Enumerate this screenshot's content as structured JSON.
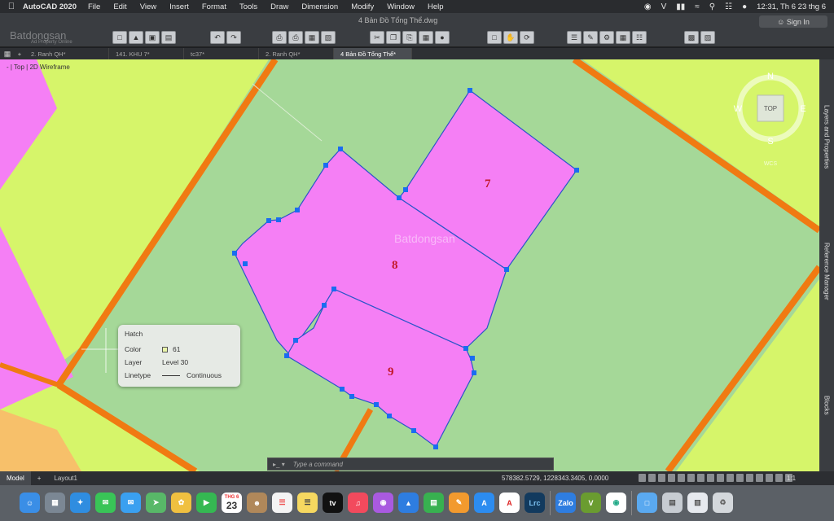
{
  "menubar": {
    "app": "AutoCAD 2020",
    "items": [
      "File",
      "Edit",
      "View",
      "Insert",
      "Format",
      "Tools",
      "Draw",
      "Dimension",
      "Modify",
      "Window",
      "Help"
    ],
    "clock": "12:31, Th 6 23 thg 6"
  },
  "toolbar": {
    "doc_title": "4 Bản Đồ Tổng Thể.dwg",
    "signin": "Sign In",
    "watermark": "Batdongsan",
    "watermark_sub": "Ad Property Online"
  },
  "tabs": [
    "2. Ranh QH*",
    "141. KHU 7*",
    "tc37*",
    "2. Ranh QH*",
    "4 Bản Đồ Tổng Thể*"
  ],
  "viewport_label": "[-][Top][2D Wireframe]",
  "viewport_short": "- | Top | 2D Wireframe",
  "viewcube": {
    "n": "N",
    "s": "S",
    "e": "E",
    "w": "W",
    "face": "TOP",
    "wcs": "WCS"
  },
  "parcels": {
    "p7": "7",
    "p8": "8",
    "p9": "9"
  },
  "canvas_watermark": "Batdongsan",
  "palettes": [
    "Layers and Properties",
    "Reference Manager",
    "Blocks"
  ],
  "hatch_tooltip": {
    "title": "Hatch",
    "color_label": "Color",
    "color_value": "61",
    "layer_label": "Layer",
    "layer_value": "Level 30",
    "linetype_label": "Linetype",
    "linetype_value": "Continuous"
  },
  "command": {
    "prompt": "▸_ ▾",
    "placeholder": "Type a command"
  },
  "status": {
    "tabs": [
      "Model",
      "Layout1"
    ],
    "coords": "578382.5729, 1228343.3405, 0.0000",
    "scale": "1:1"
  },
  "dock": {
    "calendar_month": "THG 6",
    "calendar_day": "23",
    "apps": [
      "Finder",
      "Launchpad",
      "Safari",
      "Messages",
      "Mail",
      "Maps",
      "Photos",
      "FaceTime",
      "Calendar",
      "Contacts",
      "Reminders",
      "Notes",
      "TV",
      "Music",
      "Podcasts",
      "Keynote",
      "Numbers",
      "Pages",
      "App Store",
      "AutoCAD",
      "Lightroom",
      "Zalo",
      "Vectorworks",
      "Chrome",
      "Folder",
      "Files",
      "Preview",
      "Trash"
    ]
  },
  "colors": {
    "parcel": "#f57ff5",
    "land_yellow": "#d6f56a",
    "land_green": "#a5d898",
    "road": "#f07a12",
    "grip": "#1a6cf0"
  }
}
